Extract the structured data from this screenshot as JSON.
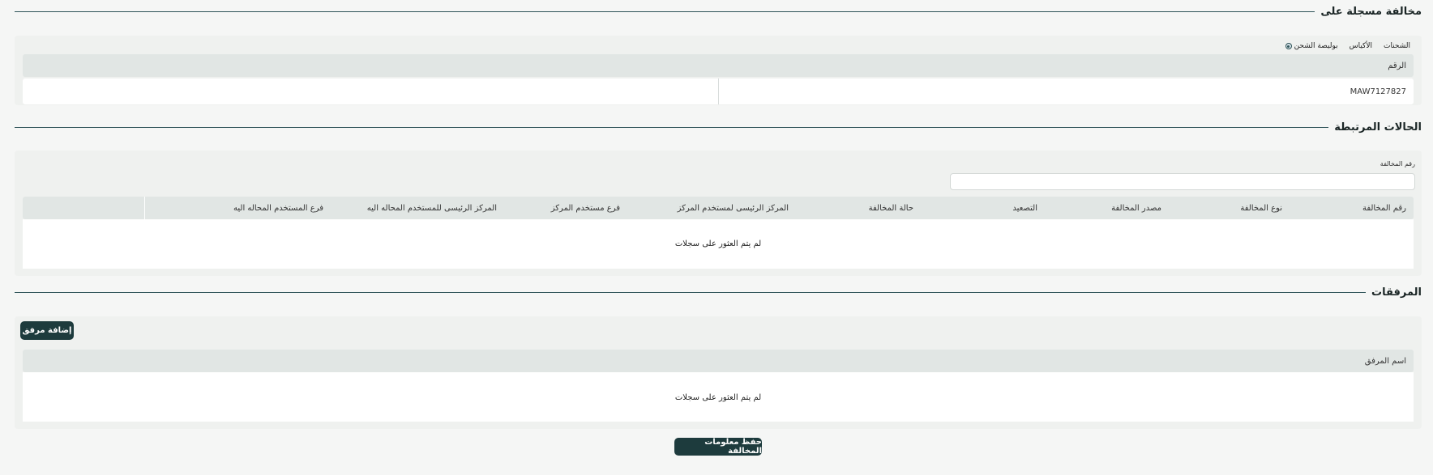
{
  "violation_on": {
    "title": "مخالفة مسجلة على",
    "tabs": [
      "الشحنات",
      "الأكياس",
      "بوليصة الشحن"
    ],
    "column_header": "الرقم",
    "value": "MAW7127827"
  },
  "related_cases": {
    "title": "الحالات المرتبطة",
    "filter_label": "رقم المخالفة",
    "filter_value": "",
    "columns": [
      "رقم المخالفة",
      "نوع المخالفة",
      "مصدر المخالفة",
      "التصعيد",
      "حالة المخالفة",
      "المركز الرئيسى لمستخدم المركز",
      "فرع مستخدم المركز",
      "المركز الرئيسى للمستخدم المحاله اليه",
      "فرع المستخدم المحاله اليه"
    ],
    "empty_text": "لم يتم العثور على سجلات"
  },
  "attachments": {
    "title": "المرفقات",
    "add_button": "إضافة مرفق",
    "column_header": "اسم المرفق",
    "empty_text": "لم يتم العثور على سجلات"
  },
  "save_button": "حفظ معلومات المخالفة"
}
